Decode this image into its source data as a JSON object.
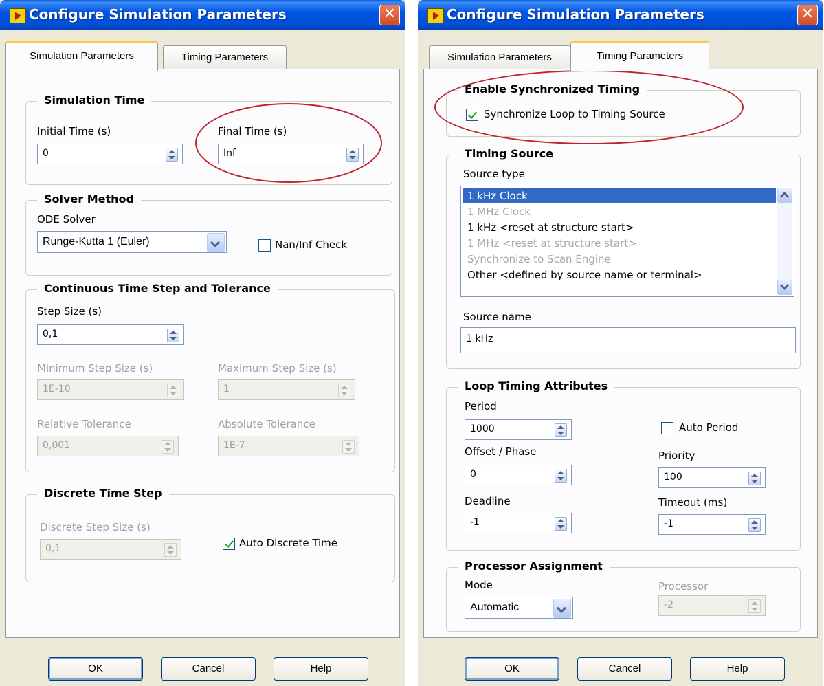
{
  "left": {
    "title": "Configure Simulation Parameters",
    "tabs": [
      "Simulation Parameters",
      "Timing Parameters"
    ],
    "simulation_time": {
      "title": "Simulation Time",
      "initial_label": "Initial Time (s)",
      "initial_value": "0",
      "final_label": "Final Time (s)",
      "final_value": "Inf"
    },
    "solver": {
      "title": "Solver Method",
      "ode_label": "ODE Solver",
      "ode_value": "Runge-Kutta 1 (Euler)",
      "naninf_label": "Nan/Inf Check",
      "naninf_checked": false
    },
    "continuous": {
      "title": "Continuous Time Step and Tolerance",
      "step_label": "Step Size (s)",
      "step_value": "0,1",
      "min_label": "Minimum Step Size (s)",
      "min_value": "1E-10",
      "max_label": "Maximum Step Size (s)",
      "max_value": "1",
      "rel_label": "Relative Tolerance",
      "rel_value": "0,001",
      "abs_label": "Absolute Tolerance",
      "abs_value": "1E-7"
    },
    "discrete": {
      "title": "Discrete Time Step",
      "step_label": "Discrete Step Size (s)",
      "step_value": "0,1",
      "auto_label": "Auto Discrete Time",
      "auto_checked": true
    },
    "buttons": {
      "ok": "OK",
      "cancel": "Cancel",
      "help": "Help"
    }
  },
  "right": {
    "title": "Configure Simulation Parameters",
    "tabs": [
      "Simulation Parameters",
      "Timing Parameters"
    ],
    "sync": {
      "title": "Enable Synchronized Timing",
      "check_label": "Synchronize Loop to Timing Source",
      "checked": true
    },
    "timing_source": {
      "title": "Timing Source",
      "type_label": "Source type",
      "items": [
        {
          "label": "1 kHz Clock",
          "state": "selected"
        },
        {
          "label": "1 MHz Clock",
          "state": "disabled"
        },
        {
          "label": "1 kHz <reset at structure start>",
          "state": "normal"
        },
        {
          "label": "1 MHz <reset at structure start>",
          "state": "disabled"
        },
        {
          "label": "Synchronize to Scan Engine",
          "state": "disabled"
        },
        {
          "label": "Other <defined by source name or terminal>",
          "state": "normal"
        }
      ],
      "name_label": "Source name",
      "name_value": "1 kHz"
    },
    "loop": {
      "title": "Loop Timing Attributes",
      "period_label": "Period",
      "period_value": "1000",
      "auto_period_label": "Auto Period",
      "auto_period_checked": false,
      "offset_label": "Offset / Phase",
      "offset_value": "0",
      "priority_label": "Priority",
      "priority_value": "100",
      "deadline_label": "Deadline",
      "deadline_value": "-1",
      "timeout_label": "Timeout (ms)",
      "timeout_value": "-1"
    },
    "processor": {
      "title": "Processor Assignment",
      "mode_label": "Mode",
      "mode_value": "Automatic",
      "proc_label": "Processor",
      "proc_value": "-2"
    },
    "buttons": {
      "ok": "OK",
      "cancel": "Cancel",
      "help": "Help"
    }
  },
  "colors": {
    "title_bar": "#0054e3",
    "highlight_circle": "#c0242a",
    "selection": "#316ac5"
  }
}
